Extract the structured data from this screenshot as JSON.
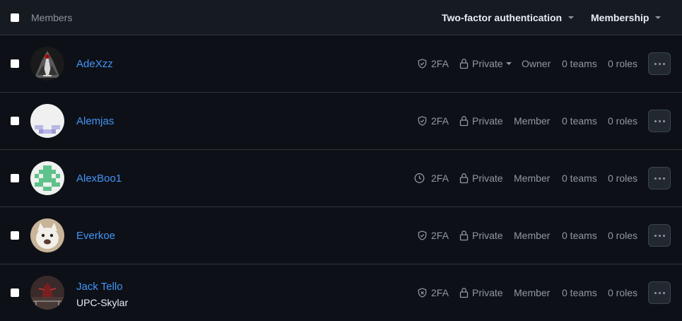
{
  "header": {
    "title": "Members",
    "two_factor_label": "Two-factor authentication",
    "membership_label": "Membership"
  },
  "members": [
    {
      "username": "AdeXzz",
      "full_name": "",
      "twofa_icon": "shield-check-icon",
      "twofa": "2FA",
      "visibility": "Private",
      "role": "Owner",
      "teams": "0 teams",
      "roles": "0 roles"
    },
    {
      "username": "Alemjas",
      "full_name": "",
      "twofa_icon": "shield-check-icon",
      "twofa": "2FA",
      "visibility": "Private",
      "role": "Member",
      "teams": "0 teams",
      "roles": "0 roles"
    },
    {
      "username": "AlexBoo1",
      "full_name": "",
      "twofa_icon": "clock-icon",
      "twofa": "2FA",
      "visibility": "Private",
      "role": "Member",
      "teams": "0 teams",
      "roles": "0 roles"
    },
    {
      "username": "Everkoe",
      "full_name": "",
      "twofa_icon": "shield-check-icon",
      "twofa": "2FA",
      "visibility": "Private",
      "role": "Member",
      "teams": "0 teams",
      "roles": "0 roles"
    },
    {
      "username": "Jack Tello",
      "full_name": "UPC-Skylar",
      "twofa_icon": "shield-x-icon",
      "twofa": "2FA",
      "visibility": "Private",
      "role": "Member",
      "teams": "0 teams",
      "roles": "0 roles"
    }
  ],
  "colors": {
    "background": "#0d1117",
    "header_bg": "#161b22",
    "border": "#30363d",
    "link": "#4493f8",
    "muted": "#9198a1"
  }
}
